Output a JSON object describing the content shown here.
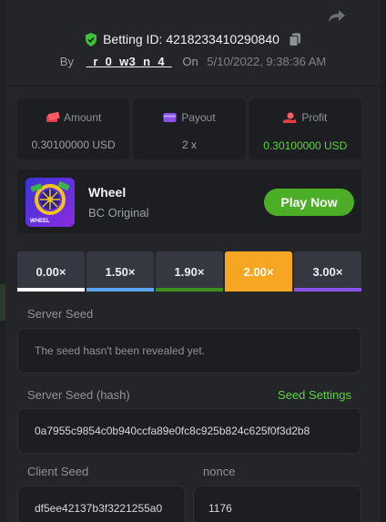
{
  "header": {
    "bet_id_label": "Betting ID: 4218233410290840",
    "by_label": "By",
    "username": "_r_0_w3_n_4_",
    "on_label": "On",
    "date": "5/10/2022, 9:38:36 AM"
  },
  "stats": [
    {
      "label": "Amount",
      "value": "0.30100000 USD",
      "icon": "money-stack-icon",
      "color": "#e83b4b"
    },
    {
      "label": "Payout",
      "value": "2 x",
      "icon": "wallet-icon",
      "color": "#8a52e8"
    },
    {
      "label": "Profit",
      "value": "0.30100000 USD",
      "icon": "hand-coin-icon",
      "color": "#e83b4b",
      "value_color": "#5fd141"
    }
  ],
  "game": {
    "name": "Wheel",
    "subtitle": "BC Original",
    "thumb_text": "WHEEL",
    "play_label": "Play Now"
  },
  "payout_tabs": [
    {
      "label": "0.00×",
      "color": "#ffffff"
    },
    {
      "label": "1.50×",
      "color": "#5aa7f0"
    },
    {
      "label": "1.90×",
      "color": "#3f8d1c"
    },
    {
      "label": "2.00×",
      "color": "#f6a623",
      "active": true
    },
    {
      "label": "3.00×",
      "color": "#8a52e8"
    }
  ],
  "server_seed": {
    "label": "Server Seed",
    "value": "The seed hasn't been revealed yet."
  },
  "server_seed_hash": {
    "label": "Server Seed (hash)",
    "settings_label": "Seed Settings",
    "value": "0a7955c9854c0b940ccfa89e0fc8c925b824c625f0f3d2b8"
  },
  "client_seed": {
    "label": "Client Seed",
    "value": "df5ee42137b3f3221255a0"
  },
  "nonce": {
    "label": "nonce",
    "value": "1176"
  }
}
